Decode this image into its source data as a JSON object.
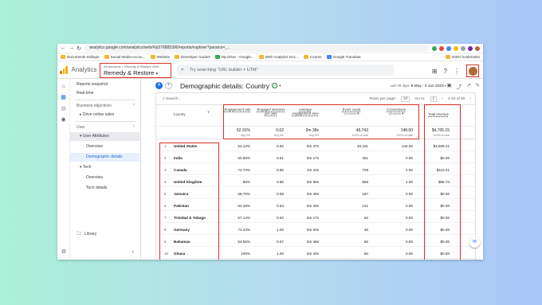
{
  "browser": {
    "url": "analytics.google.com/analytics/web/#/p376885390/reports/explorer?params=_...",
    "bookmarks": [
      "Documents Skillupe",
      "Social Media Accou...",
      "Website",
      "Developer Guides",
      "My Drive - Google...",
      "Web Analytics Doc...",
      "Course",
      "Google Translate"
    ],
    "other_bookmarks": "Other bookmarks"
  },
  "header": {
    "app_title": "Analytics",
    "account_crumb": "All accounts > Remedy & Restore Well...",
    "property": "Remedy & Restore",
    "search_placeholder": "Try searching \"URL builder + UTM\""
  },
  "sidebar": {
    "items": [
      {
        "label": "Reports snapshot"
      },
      {
        "label": "Real-time"
      }
    ],
    "business_objectives": "Business objectives",
    "drive_online_sales": "Drive online sales",
    "user_section": "User",
    "user_attributes": "User Attributes",
    "overview1": "Overview",
    "demographic_details": "Demographic details",
    "tech": "Tech",
    "overview2": "Overview",
    "tech_details": "Tech details",
    "library": "Library"
  },
  "report": {
    "badge": "A",
    "title": "Demographic details: Country",
    "date_prefix": "Last 28 days",
    "date_range": "9 May - 5 Jun 2023",
    "search_label": "Search...",
    "rows_per_page_label": "Rows per page:",
    "rows_per_page": "10",
    "goto_label": "Go to:",
    "goto": "1",
    "pagination": "1-10 of 50"
  },
  "table": {
    "dimension_header": "Country",
    "columns": [
      {
        "label": "Engagement rate"
      },
      {
        "label": "Engaged sessions per user"
      },
      {
        "label": "Average engagement time"
      },
      {
        "label": "Event count",
        "sub": "All events"
      },
      {
        "label": "Conversions",
        "sub": "All events"
      },
      {
        "label": "Total revenue"
      }
    ],
    "totals": [
      {
        "value": "52.91%",
        "sub": "Avg 0%"
      },
      {
        "value": "0.62",
        "sub": "Avg 0%"
      },
      {
        "value": "0m 38s",
        "sub": "Avg 0%"
      },
      {
        "value": "49,743",
        "sub": "100% of total"
      },
      {
        "value": "148.00",
        "sub": "100% of total"
      },
      {
        "value": "$4,705.15",
        "sub": "100% of total"
      }
    ],
    "rows": [
      {
        "idx": "1",
        "country": "United States",
        "engagement_rate": "52.14%",
        "engaged_sessions": "0.62",
        "avg_time": "0m 37s",
        "events": "46,101",
        "conversions": "144.00",
        "revenue": "$4,505.21"
      },
      {
        "idx": "2",
        "country": "India",
        "engagement_rate": "50.56%",
        "engaged_sessions": "0.51",
        "avg_time": "0m 17s",
        "events": "461",
        "conversions": "0.00",
        "revenue": "$0.00"
      },
      {
        "idx": "3",
        "country": "Canada",
        "engagement_rate": "72.73%",
        "engaged_sessions": "0.86",
        "avg_time": "1m 24s",
        "events": "728",
        "conversions": "2.00",
        "revenue": "$110.31"
      },
      {
        "idx": "4",
        "country": "United Kingdom",
        "engagement_rate": "86%",
        "engaged_sessions": "0.86",
        "avg_time": "0m 55s",
        "events": "559",
        "conversions": "1.00",
        "revenue": "$65.74"
      },
      {
        "idx": "5",
        "country": "Jamaica",
        "engagement_rate": "68.75%",
        "engaged_sessions": "0.69",
        "avg_time": "0m 45s",
        "events": "197",
        "conversions": "0.00",
        "revenue": "$0.00"
      },
      {
        "idx": "6",
        "country": "Pakistan",
        "engagement_rate": "64.29%",
        "engaged_sessions": "0.64",
        "avg_time": "0m 26s",
        "events": "141",
        "conversions": "0.00",
        "revenue": "$0.00"
      },
      {
        "idx": "7",
        "country": "Trinidad & Tobago",
        "engagement_rate": "57.14%",
        "engaged_sessions": "0.62",
        "avg_time": "0m 17s",
        "events": "62",
        "conversions": "0.00",
        "revenue": "$0.00"
      },
      {
        "idx": "8",
        "country": "Germany",
        "engagement_rate": "71.43%",
        "engaged_sessions": "1.00",
        "avg_time": "0m 53s",
        "events": "46",
        "conversions": "0.00",
        "revenue": "$0.00"
      },
      {
        "idx": "9",
        "country": "Bahamas",
        "engagement_rate": "54.55%",
        "engaged_sessions": "0.67",
        "avg_time": "0m 48s",
        "events": "56",
        "conversions": "0.00",
        "revenue": "$0.00"
      },
      {
        "idx": "10",
        "country": "Ghana",
        "engagement_rate": "100%",
        "engaged_sessions": "1.00",
        "avg_time": "0m 26s",
        "events": "50",
        "conversions": "0.00",
        "revenue": "$0.00"
      }
    ]
  },
  "colors": {
    "accent": "#1a73e8",
    "highlight_box": "#d93025",
    "logo_orange": "#f9ab00",
    "logo_dark_orange": "#e37400"
  }
}
